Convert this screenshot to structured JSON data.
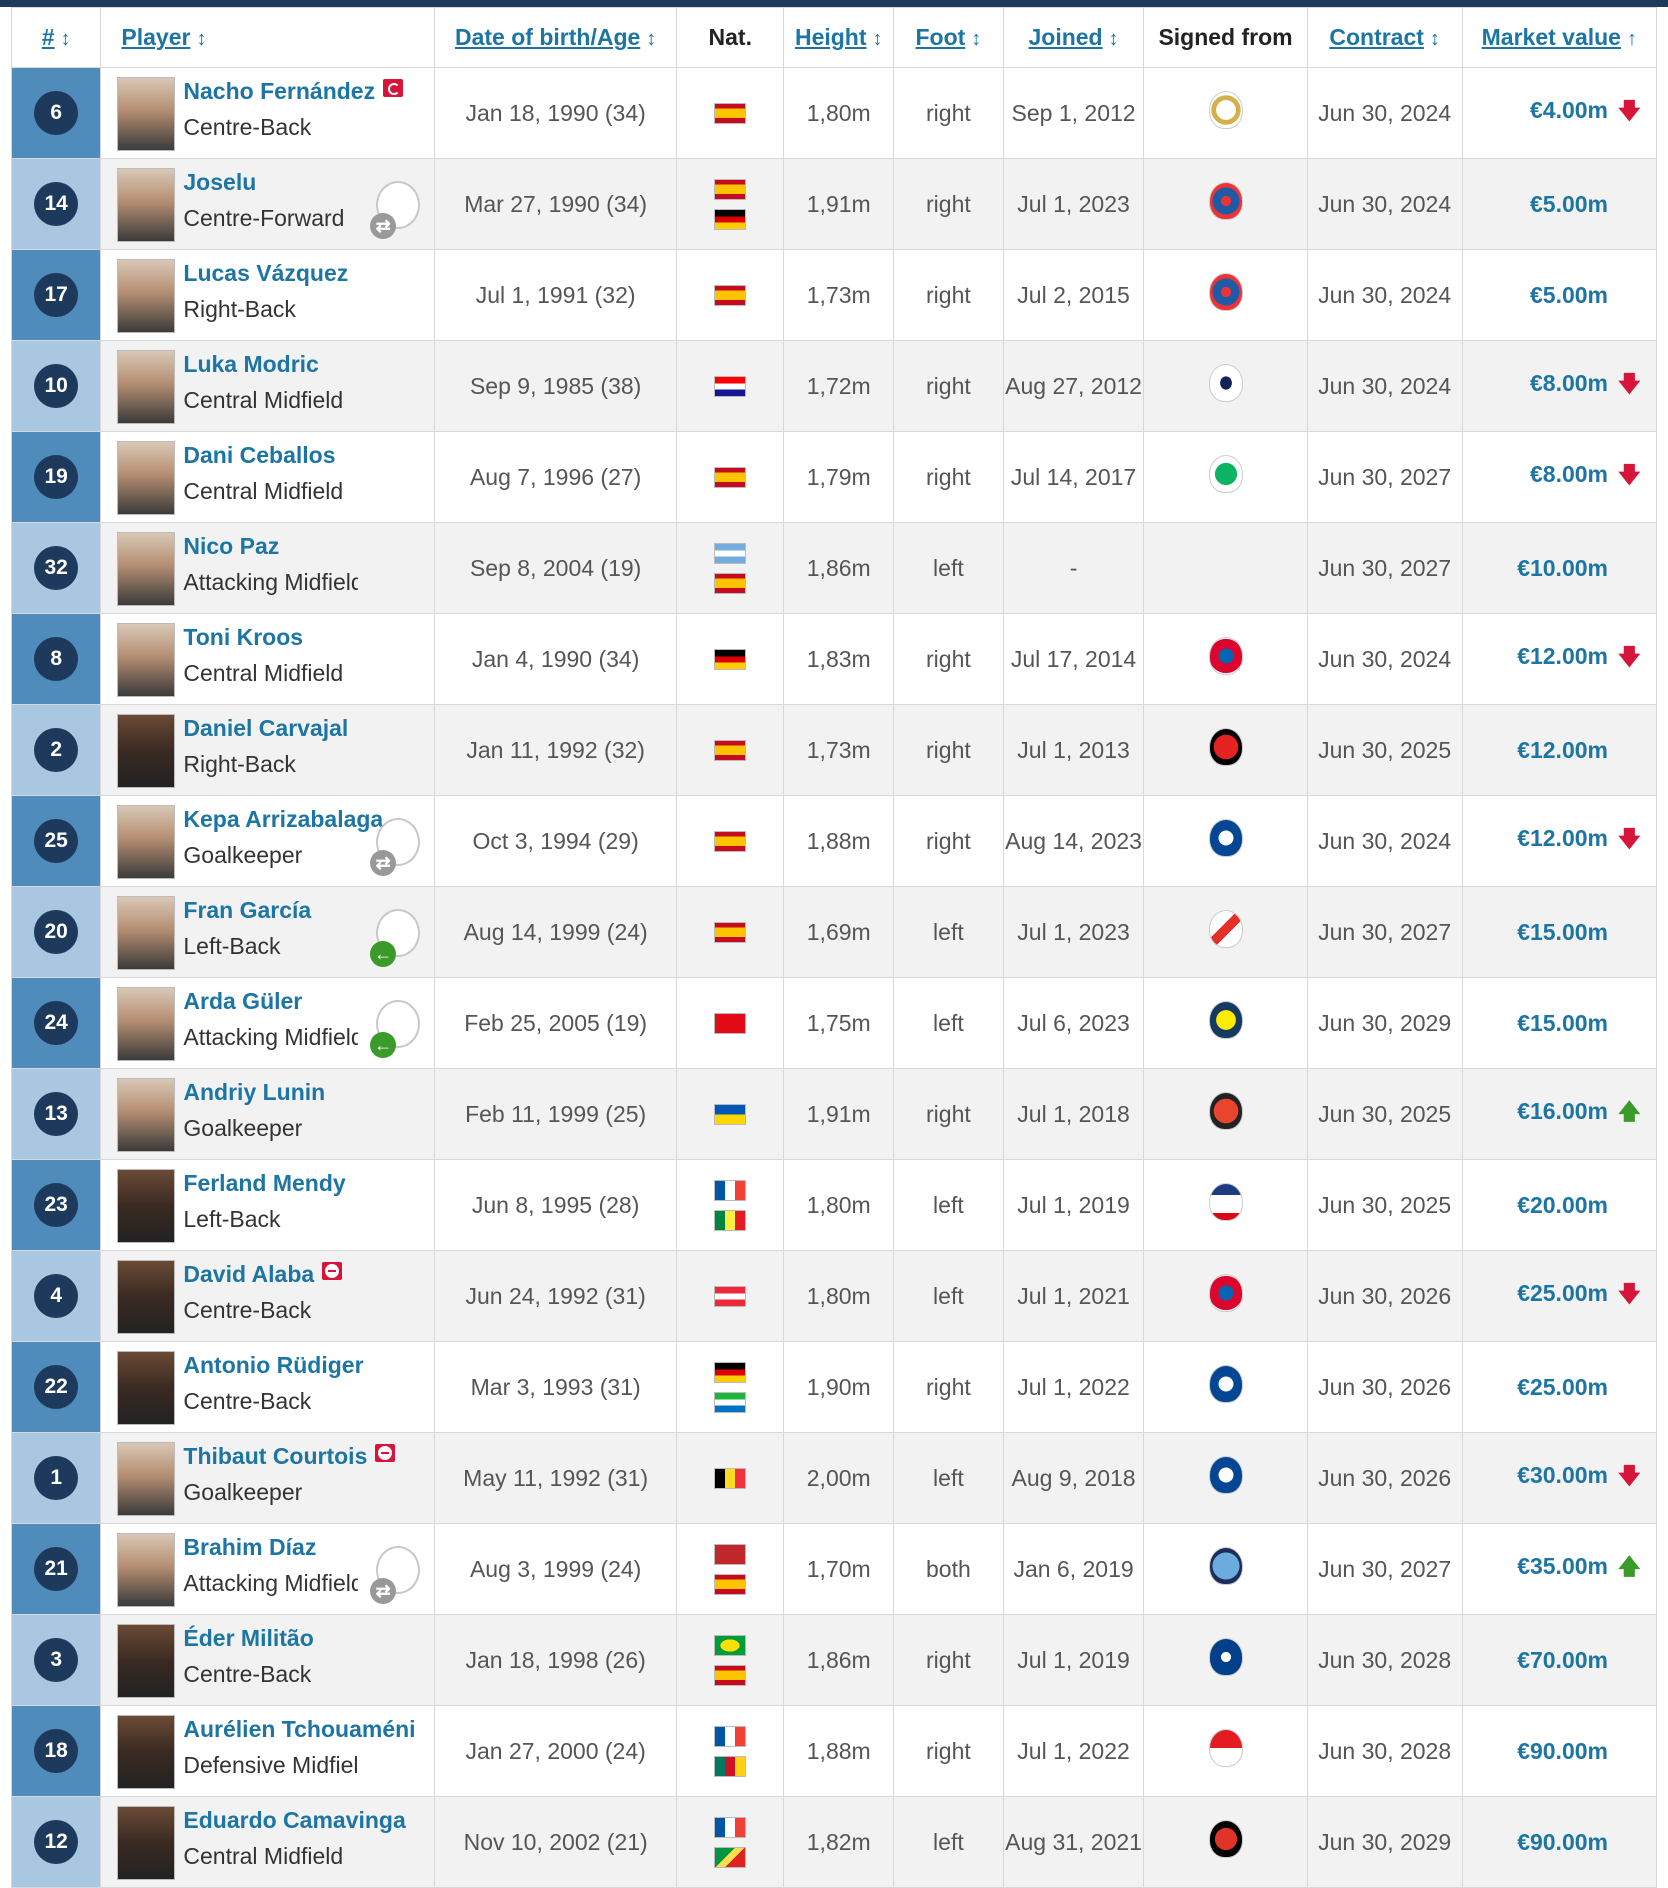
{
  "headers": {
    "num": "#",
    "player": "Player",
    "dob": "Date of birth/Age",
    "nat": "Nat.",
    "height": "Height",
    "foot": "Foot",
    "joined": "Joined",
    "signed_from": "Signed from",
    "contract": "Contract",
    "market_value": "Market value"
  },
  "colors": {
    "header_bar": "#1d3a5c",
    "link": "#1d75a3",
    "down": "#d7153a",
    "up": "#3a9a2a"
  },
  "players": [
    {
      "num": "6",
      "name": "Nacho Fernández",
      "position": "Centre-Back",
      "dob": "Jan 18, 1990 (34)",
      "flags": [
        "spain"
      ],
      "height": "1,80m",
      "foot": "right",
      "joined": "Sep 1, 2012",
      "club_icon": "real-madrid-castilla",
      "contract": "Jun 30, 2024",
      "market_value": "€4.00m",
      "trend": "down",
      "badge": "captain"
    },
    {
      "num": "14",
      "name": "Joselu",
      "position": "Centre-Forward",
      "dob": "Mar 27, 1990 (34)",
      "flags": [
        "spain",
        "germany"
      ],
      "height": "1,91m",
      "foot": "right",
      "joined": "Jul 1, 2023",
      "club_icon": "espanyol",
      "contract": "Jun 30, 2024",
      "market_value": "€5.00m",
      "trend": "none",
      "loan": "out-grey"
    },
    {
      "num": "17",
      "name": "Lucas Vázquez",
      "position": "Right-Back",
      "dob": "Jul 1, 1991 (32)",
      "flags": [
        "spain"
      ],
      "height": "1,73m",
      "foot": "right",
      "joined": "Jul 2, 2015",
      "club_icon": "espanyol",
      "contract": "Jun 30, 2024",
      "market_value": "€5.00m",
      "trend": "none"
    },
    {
      "num": "10",
      "name": "Luka Modric",
      "position": "Central Midfield",
      "dob": "Sep 9, 1985 (38)",
      "flags": [
        "croatia"
      ],
      "height": "1,72m",
      "foot": "right",
      "joined": "Aug 27, 2012",
      "club_icon": "tottenham",
      "contract": "Jun 30, 2024",
      "market_value": "€8.00m",
      "trend": "down"
    },
    {
      "num": "19",
      "name": "Dani Ceballos",
      "position": "Central Midfield",
      "dob": "Aug 7, 1996 (27)",
      "flags": [
        "spain"
      ],
      "height": "1,79m",
      "foot": "right",
      "joined": "Jul 14, 2017",
      "club_icon": "real-betis",
      "contract": "Jun 30, 2027",
      "market_value": "€8.00m",
      "trend": "down"
    },
    {
      "num": "32",
      "name": "Nico Paz",
      "position": "Attacking Midfield",
      "dob": "Sep 8, 2004 (19)",
      "flags": [
        "argentina",
        "spain"
      ],
      "height": "1,86m",
      "foot": "left",
      "joined": "-",
      "club_icon": "",
      "contract": "Jun 30, 2027",
      "market_value": "€10.00m",
      "trend": "none"
    },
    {
      "num": "8",
      "name": "Toni Kroos",
      "position": "Central Midfield",
      "dob": "Jan 4, 1990 (34)",
      "flags": [
        "germany"
      ],
      "height": "1,83m",
      "foot": "right",
      "joined": "Jul 17, 2014",
      "club_icon": "bayern-munich",
      "contract": "Jun 30, 2024",
      "market_value": "€12.00m",
      "trend": "down"
    },
    {
      "num": "2",
      "name": "Daniel Carvajal",
      "position": "Right-Back",
      "dob": "Jan 11, 1992 (32)",
      "flags": [
        "spain"
      ],
      "height": "1,73m",
      "foot": "right",
      "joined": "Jul 1, 2013",
      "club_icon": "bayer-leverkusen",
      "contract": "Jun 30, 2025",
      "market_value": "€12.00m",
      "trend": "none"
    },
    {
      "num": "25",
      "name": "Kepa Arrizabalaga",
      "position": "Goalkeeper",
      "dob": "Oct 3, 1994 (29)",
      "flags": [
        "spain"
      ],
      "height": "1,88m",
      "foot": "right",
      "joined": "Aug 14, 2023",
      "club_icon": "chelsea",
      "contract": "Jun 30, 2024",
      "market_value": "€12.00m",
      "trend": "down",
      "loan": "out-grey"
    },
    {
      "num": "20",
      "name": "Fran García",
      "position": "Left-Back",
      "dob": "Aug 14, 1999 (24)",
      "flags": [
        "spain"
      ],
      "height": "1,69m",
      "foot": "left",
      "joined": "Jul 1, 2023",
      "club_icon": "rayo-vallecano",
      "contract": "Jun 30, 2027",
      "market_value": "€15.00m",
      "trend": "none",
      "loan": "back-green"
    },
    {
      "num": "24",
      "name": "Arda Güler",
      "position": "Attacking Midfield",
      "dob": "Feb 25, 2005 (19)",
      "flags": [
        "turkey"
      ],
      "height": "1,75m",
      "foot": "left",
      "joined": "Jul 6, 2023",
      "club_icon": "fenerbahce",
      "contract": "Jun 30, 2029",
      "market_value": "€15.00m",
      "trend": "none",
      "loan": "back-green"
    },
    {
      "num": "13",
      "name": "Andriy Lunin",
      "position": "Goalkeeper",
      "dob": "Feb 11, 1999 (25)",
      "flags": [
        "ukraine"
      ],
      "height": "1,91m",
      "foot": "right",
      "joined": "Jul 1, 2018",
      "club_icon": "zorya-luhansk",
      "contract": "Jun 30, 2025",
      "market_value": "€16.00m",
      "trend": "up"
    },
    {
      "num": "23",
      "name": "Ferland Mendy",
      "position": "Left-Back",
      "dob": "Jun 8, 1995 (28)",
      "flags": [
        "france",
        "senegal"
      ],
      "height": "1,80m",
      "foot": "left",
      "joined": "Jul 1, 2019",
      "club_icon": "olympique-lyon",
      "contract": "Jun 30, 2025",
      "market_value": "€20.00m",
      "trend": "none"
    },
    {
      "num": "4",
      "name": "David Alaba",
      "position": "Centre-Back",
      "dob": "Jun 24, 1992 (31)",
      "flags": [
        "austria"
      ],
      "height": "1,80m",
      "foot": "left",
      "joined": "Jul 1, 2021",
      "club_icon": "bayern-munich",
      "contract": "Jun 30, 2026",
      "market_value": "€25.00m",
      "trend": "down",
      "badge": "injury"
    },
    {
      "num": "22",
      "name": "Antonio Rüdiger",
      "position": "Centre-Back",
      "dob": "Mar 3, 1993 (31)",
      "flags": [
        "germany",
        "sierra-leone"
      ],
      "height": "1,90m",
      "foot": "right",
      "joined": "Jul 1, 2022",
      "club_icon": "chelsea",
      "contract": "Jun 30, 2026",
      "market_value": "€25.00m",
      "trend": "none"
    },
    {
      "num": "1",
      "name": "Thibaut Courtois",
      "position": "Goalkeeper",
      "dob": "May 11, 1992 (31)",
      "flags": [
        "belgium"
      ],
      "height": "2,00m",
      "foot": "left",
      "joined": "Aug 9, 2018",
      "club_icon": "chelsea",
      "contract": "Jun 30, 2026",
      "market_value": "€30.00m",
      "trend": "down",
      "badge": "injury"
    },
    {
      "num": "21",
      "name": "Brahim Díaz",
      "position": "Attacking Midfield",
      "dob": "Aug 3, 1999 (24)",
      "flags": [
        "morocco",
        "spain"
      ],
      "height": "1,70m",
      "foot": "both",
      "joined": "Jan 6, 2019",
      "club_icon": "manchester-city",
      "contract": "Jun 30, 2027",
      "market_value": "€35.00m",
      "trend": "up",
      "loan": "out-grey"
    },
    {
      "num": "3",
      "name": "Éder Militão",
      "position": "Centre-Back",
      "dob": "Jan 18, 1998 (26)",
      "flags": [
        "brazil",
        "spain"
      ],
      "height": "1,86m",
      "foot": "right",
      "joined": "Jul 1, 2019",
      "club_icon": "fc-porto",
      "contract": "Jun 30, 2028",
      "market_value": "€70.00m",
      "trend": "none"
    },
    {
      "num": "18",
      "name": "Aurélien Tchouaméni",
      "position": "Defensive Midfield",
      "dob": "Jan 27, 2000 (24)",
      "flags": [
        "france",
        "cameroon"
      ],
      "height": "1,88m",
      "foot": "right",
      "joined": "Jul 1, 2022",
      "club_icon": "as-monaco",
      "contract": "Jun 30, 2028",
      "market_value": "€90.00m",
      "trend": "none"
    },
    {
      "num": "12",
      "name": "Eduardo Camavinga",
      "position": "Central Midfield",
      "dob": "Nov 10, 2002 (21)",
      "flags": [
        "france",
        "congo"
      ],
      "height": "1,82m",
      "foot": "left",
      "joined": "Aug 31, 2021",
      "club_icon": "stade-rennais",
      "contract": "Jun 30, 2029",
      "market_value": "€90.00m",
      "trend": "none"
    }
  ]
}
